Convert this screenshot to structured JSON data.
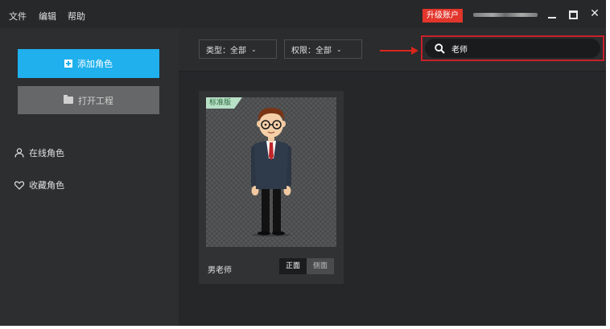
{
  "menu": {
    "file": "文件",
    "edit": "编辑",
    "help": "帮助"
  },
  "header": {
    "upgrade_label": "升级账户"
  },
  "sidebar": {
    "add_role": "添加角色",
    "open_project": "打开工程",
    "online_roles": "在线角色",
    "favorite_roles": "收藏角色"
  },
  "filters": {
    "type": {
      "label": "类型：",
      "value": "全部"
    },
    "permission": {
      "label": "权限：",
      "value": "全部"
    }
  },
  "search": {
    "value": "老师"
  },
  "cards": [
    {
      "badge": "标准版",
      "name": "男老师",
      "view_front": "正面",
      "view_side": "侧面"
    }
  ],
  "colors": {
    "accent": "#1fb0ed",
    "upgrade": "#e2352b",
    "annotation": "#c8202a",
    "badge": "#b8e0c7"
  }
}
